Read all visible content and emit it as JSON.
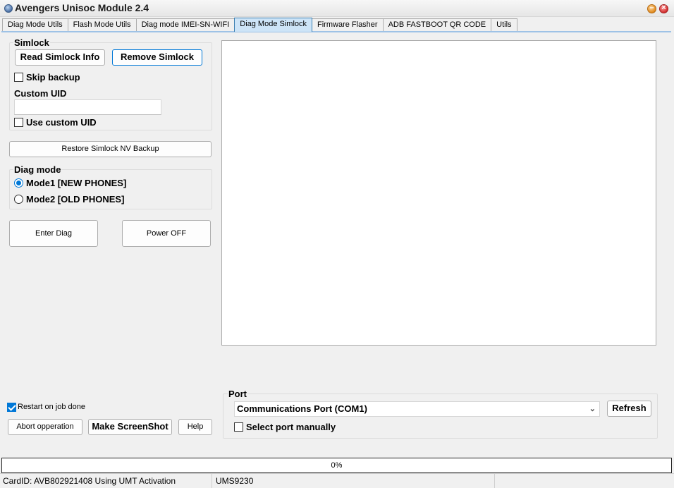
{
  "window": {
    "title": "Avengers Unisoc Module 2.4",
    "buttons": {
      "minimize": "–",
      "restore": "",
      "close": "×"
    }
  },
  "tabs": [
    {
      "label": "Diag Mode Utils",
      "active": false
    },
    {
      "label": "Flash Mode Utils",
      "active": false
    },
    {
      "label": "Diag mode IMEI-SN-WIFI",
      "active": false
    },
    {
      "label": "Diag Mode Simlock",
      "active": true
    },
    {
      "label": "Firmware Flasher",
      "active": false
    },
    {
      "label": "ADB FASTBOOT QR CODE",
      "active": false
    },
    {
      "label": "Utils",
      "active": false
    }
  ],
  "simlock": {
    "title": "Simlock",
    "read_button": "Read Simlock Info",
    "remove_button": "Remove Simlock",
    "skip_backup": {
      "label": "Skip backup",
      "checked": false
    },
    "custom_uid_label": "Custom UID",
    "custom_uid_value": "",
    "use_custom_uid": {
      "label": "Use custom UID",
      "checked": false
    }
  },
  "restore_button": "Restore Simlock NV Backup",
  "diag_mode": {
    "title": "Diag mode",
    "mode1": {
      "label": "Mode1  [NEW PHONES]",
      "selected": true
    },
    "mode2": {
      "label": "Mode2 [OLD PHONES]",
      "selected": false
    }
  },
  "actions": {
    "enter_diag": "Enter Diag",
    "power_off": "Power OFF"
  },
  "bottom_left": {
    "restart_on_done": {
      "label": "Restart on job done",
      "checked": true
    },
    "abort_button": "Abort opperation",
    "screenshot_button": "Make ScreenShot",
    "help_button": "Help"
  },
  "port": {
    "title": "Port",
    "selected": "Communications Port (COM1)",
    "refresh_button": "Refresh",
    "select_manually": {
      "label": "Select port manually",
      "checked": false
    }
  },
  "progress": {
    "value": 0,
    "text": "0%"
  },
  "status": {
    "card": "CardID: AVB802921408 Using UMT Activation",
    "chip": "UMS9230",
    "extra": ""
  },
  "colors": {
    "accent": "#0078d7",
    "tab_active": "#cde4f7",
    "background": "#f0f0f0"
  }
}
